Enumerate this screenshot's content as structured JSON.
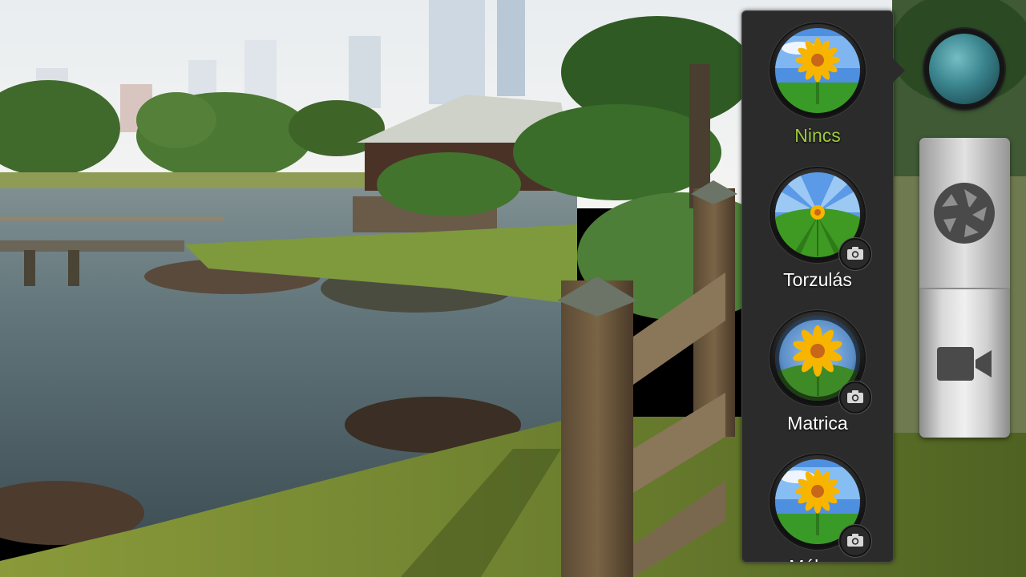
{
  "effects_panel": {
    "items": [
      {
        "label": "Nincs",
        "selected": true,
        "has_camera_badge": false,
        "thumb": "sunflower-icon"
      },
      {
        "label": "Torzulás",
        "selected": false,
        "has_camera_badge": true,
        "thumb": "sunflower-stretch-icon"
      },
      {
        "label": "Matrica",
        "selected": false,
        "has_camera_badge": true,
        "thumb": "sunflower-fisheye-icon"
      },
      {
        "label": "Mély…",
        "selected": false,
        "has_camera_badge": true,
        "thumb": "sunflower-icon"
      }
    ]
  },
  "controls": {
    "current_effect": "lens-effect-icon",
    "modes": [
      {
        "name": "photo",
        "icon": "shutter-icon",
        "active": true
      },
      {
        "name": "video",
        "icon": "video-camera-icon",
        "active": false
      }
    ]
  },
  "colors": {
    "selected_label": "#9ccb3c",
    "panel_bg": "#2b2b2b",
    "label_default": "#ffffff"
  }
}
